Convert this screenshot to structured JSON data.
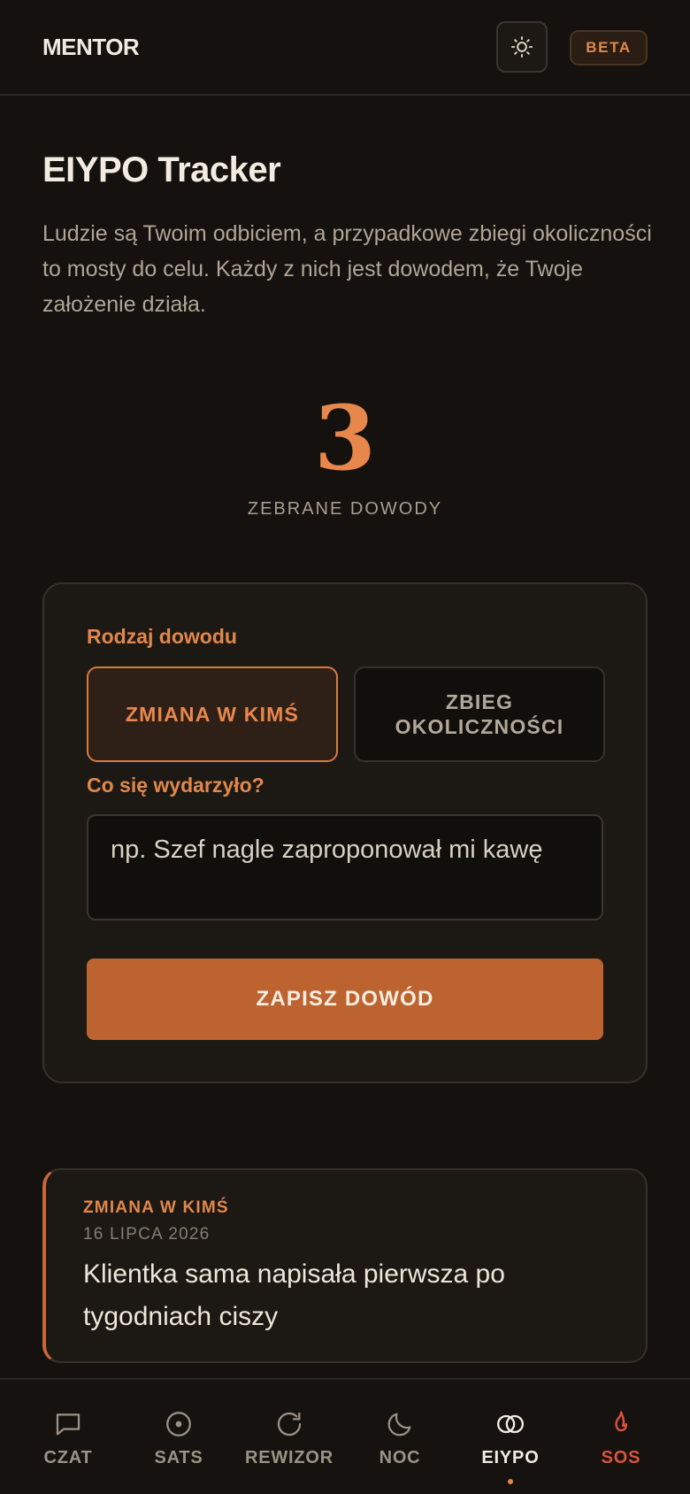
{
  "header": {
    "brand": "MENTOR",
    "theme_icon": "sun-icon",
    "badge": "BETA"
  },
  "page": {
    "title": "EIYPO Tracker",
    "description": "Ludzie są Twoim odbiciem, a przypadkowe zbiegi okoliczności to mosty do celu. Każdy z nich jest dowodem, że Twoje założenie działa."
  },
  "counter": {
    "value": "3",
    "label": "ZEBRANE DOWODY"
  },
  "form": {
    "type_label": "Rodzaj dowodu",
    "types": [
      {
        "label": "ZMIANA W KIMŚ",
        "selected": true
      },
      {
        "label": "ZBIEG OKOLICZNOŚCI",
        "selected": false
      }
    ],
    "event_label": "Co się wydarzyło?",
    "event_placeholder": "np. Szef nagle zaproponował mi kawę",
    "event_value": "",
    "submit_label": "ZAPISZ DOWÓD"
  },
  "entries": [
    {
      "type": "ZMIANA W KIMŚ",
      "date": "16 LIPCA 2026",
      "text": "Klientka sama napisała pierwsza po tygodniach ciszy"
    }
  ],
  "nav": {
    "active": "EIYPO",
    "items": [
      {
        "label": "CZAT",
        "icon": "chat-icon"
      },
      {
        "label": "SATS",
        "icon": "target-icon"
      },
      {
        "label": "REWIZOR",
        "icon": "refresh-icon"
      },
      {
        "label": "NOC",
        "icon": "moon-icon"
      },
      {
        "label": "EIYPO",
        "icon": "rings-icon"
      },
      {
        "label": "SOS",
        "icon": "flame-icon"
      }
    ]
  },
  "colors": {
    "accent": "#e2874a",
    "button": "#bd6330",
    "background": "#14110e",
    "sos": "#d9533e"
  }
}
